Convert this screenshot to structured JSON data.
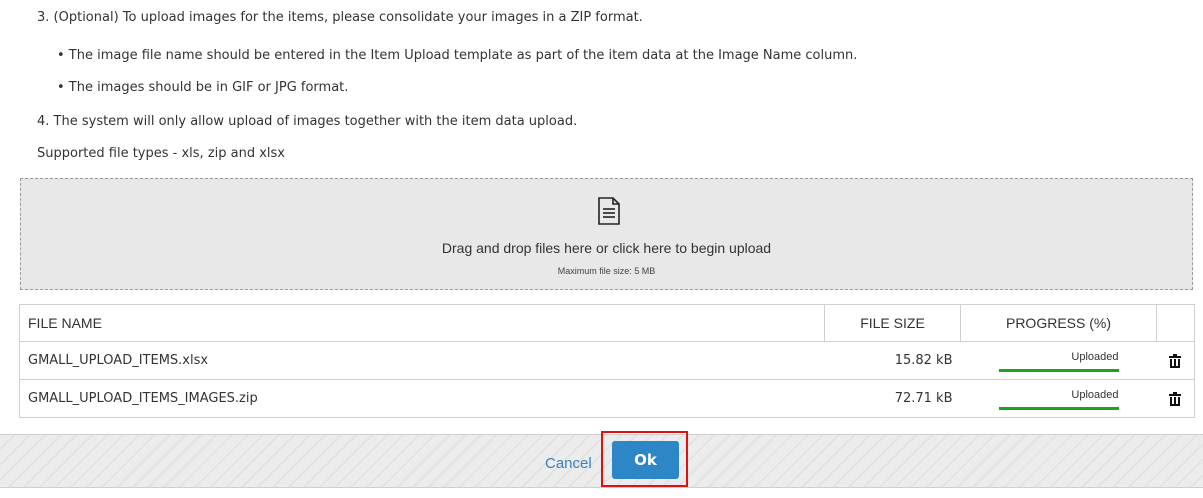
{
  "instructions": {
    "step3": "3. (Optional) To upload images for the items, please consolidate your images in a ZIP format.",
    "step3_bullet1": "• The image file name should be entered in the Item Upload template as part of the item data at the Image Name column.",
    "step3_bullet2": "• The images should be in GIF or JPG format.",
    "step4": "4. The system will only allow upload of images together with the item data upload.",
    "supported": "Supported file types - xls, zip and xlsx"
  },
  "dropzone": {
    "icon": "document-icon",
    "main_text": "Drag and drop files here or click here to begin upload",
    "sub_text": "Maximum file size: 5 MB"
  },
  "file_table": {
    "headers": {
      "name": "FILE NAME",
      "size": "FILE SIZE",
      "progress": "PROGRESS (%)"
    },
    "rows": [
      {
        "name": "GMALL_UPLOAD_ITEMS.xlsx",
        "size": "15.82 kB",
        "status": "Uploaded",
        "progress": 100,
        "delete_icon": "trash-icon"
      },
      {
        "name": "GMALL_UPLOAD_ITEMS_IMAGES.zip",
        "size": "72.71 kB",
        "status": "Uploaded",
        "progress": 100,
        "delete_icon": "trash-icon"
      }
    ]
  },
  "footer": {
    "cancel_label": "Cancel",
    "ok_label": "Ok"
  },
  "colors": {
    "accent_blue": "#2d87c6",
    "link_blue": "#3a7fc1",
    "progress_green": "#1aa51a",
    "highlight_red": "#e01010"
  }
}
